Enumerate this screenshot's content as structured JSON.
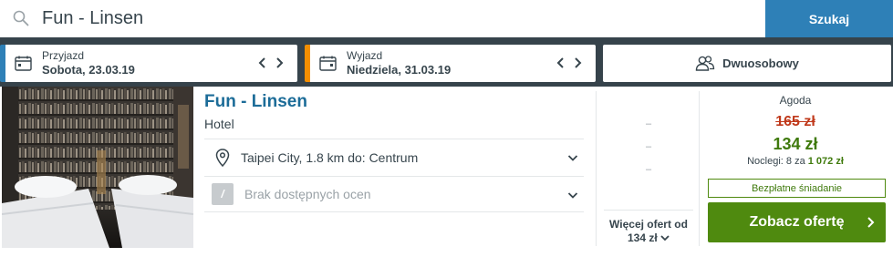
{
  "search": {
    "value": "Fun - Linsen",
    "button_label": "Szukaj"
  },
  "dates": {
    "checkin_label": "Przyjazd",
    "checkin_value": "Sobota, 23.03.19",
    "checkout_label": "Wyjazd",
    "checkout_value": "Niedziela, 31.03.19",
    "room_label": "Dwuosobowy"
  },
  "hotel": {
    "name": "Fun - Linsen",
    "type": "Hotel",
    "location": "Taipei City, 1.8 km do: Centrum",
    "rating_badge": "/",
    "rating_text": "Brak dostępnych ocen",
    "placeholder_dashes": [
      "–",
      "–",
      "–"
    ],
    "more_offers_line1": "Więcej ofert od",
    "more_offers_line2": "134 zł"
  },
  "offer": {
    "provider": "Agoda",
    "old_price": "165 zł",
    "new_price": "134 zł",
    "nights_prefix": "Noclegi: 8 za",
    "nights_total": "1 072 zł",
    "free_breakfast": "Bezpłatne śniadanie",
    "deal_button": "Zobacz ofertę"
  },
  "icons": {
    "search": "search-icon",
    "calendar": "calendar-icon",
    "arrows": "prev-next-arrows-icon",
    "guests": "guests-icon",
    "pin": "location-pin-icon",
    "chevron": "chevron-down-icon",
    "deal_chevron": "chevron-right-icon"
  },
  "colors": {
    "accent_blue": "#2e80b7",
    "accent_orange": "#f48f00",
    "bar_dark": "#36434b",
    "price_old": "#c0391b",
    "price_green": "#3f7a0c",
    "button_green": "#4f8a0f",
    "hotel_link": "#1c6c98"
  }
}
